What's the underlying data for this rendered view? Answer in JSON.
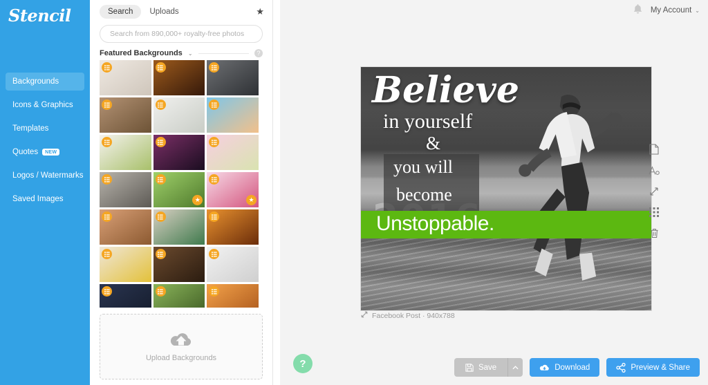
{
  "brand": {
    "name": "Stencil",
    "sidebar_color": "#33a2e5",
    "accent_blue": "#3ea0ee",
    "accent_green": "#5cb811",
    "badge_orange": "#f5a623",
    "help_green": "#84dcab"
  },
  "sidebar": {
    "logo": "Stencil",
    "items": [
      {
        "label": "Backgrounds",
        "active": true,
        "badge": ""
      },
      {
        "label": "Icons & Graphics",
        "active": false,
        "badge": ""
      },
      {
        "label": "Templates",
        "active": false,
        "badge": ""
      },
      {
        "label": "Quotes",
        "active": false,
        "badge": "NEW"
      },
      {
        "label": "Logos / Watermarks",
        "active": false,
        "badge": ""
      },
      {
        "label": "Saved Images",
        "active": false,
        "badge": ""
      }
    ]
  },
  "panel": {
    "tabs": [
      {
        "label": "Search",
        "active": true
      },
      {
        "label": "Uploads",
        "active": false
      }
    ],
    "favorites_icon": "star-icon",
    "search": {
      "value": "",
      "placeholder": "Search from 890,000+ royalty-free photos"
    },
    "section": {
      "title": "Featured Backgrounds",
      "caret": "⌄",
      "help_icon": "question-circle-icon",
      "help_glyph": "?"
    },
    "thumbnails": [
      {
        "alt": "desk-keyboard-notebook-coffee",
        "badge": "list-icon",
        "premium": false,
        "c1": "#efe9e2",
        "c2": "#cfc6bb"
      },
      {
        "alt": "sunset-through-grass",
        "badge": "list-icon",
        "premium": false,
        "c1": "#9c5a1c",
        "c2": "#35190a"
      },
      {
        "alt": "people-meeting-office",
        "badge": "list-icon",
        "premium": false,
        "c1": "#6d6f72",
        "c2": "#2e3135"
      },
      {
        "alt": "blank-picture-frame-wood",
        "badge": "list-icon",
        "premium": false,
        "c1": "#b39274",
        "c2": "#6d5336"
      },
      {
        "alt": "white-desk-plant-laptop",
        "badge": "list-icon",
        "premium": false,
        "c1": "#f0f0ee",
        "c2": "#c9cdc6"
      },
      {
        "alt": "ocean-sunset-horizon",
        "badge": "list-icon",
        "premium": false,
        "c1": "#7ec6e8",
        "c2": "#f2c08a"
      },
      {
        "alt": "pink-rose-leaves",
        "badge": "list-icon",
        "premium": false,
        "c1": "#f5f2ee",
        "c2": "#a8c06a"
      },
      {
        "alt": "purple-dramatic-sky-tree",
        "badge": "list-icon",
        "premium": false,
        "c1": "#7b2f66",
        "c2": "#1a0d20"
      },
      {
        "alt": "pastel-candy-hearts",
        "badge": "list-icon",
        "premium": false,
        "c1": "#f7cfe0",
        "c2": "#d9e3b0"
      },
      {
        "alt": "couple-street-balloons",
        "badge": "list-icon",
        "premium": false,
        "c1": "#b8b4ac",
        "c2": "#5d5a55"
      },
      {
        "alt": "green-field-lone-tree",
        "badge": "list-icon",
        "premium": true,
        "c1": "#9fd06a",
        "c2": "#4f7a2c"
      },
      {
        "alt": "pink-peony-flower-closeup",
        "badge": "list-icon",
        "premium": true,
        "c1": "#f6d9e6",
        "c2": "#d4557e"
      },
      {
        "alt": "coffee-cups-macarons",
        "badge": "list-icon",
        "premium": false,
        "c1": "#d9a077",
        "c2": "#8c5a31"
      },
      {
        "alt": "colorful-tools-flatlay",
        "badge": "list-icon",
        "premium": false,
        "c1": "#d8cfc2",
        "c2": "#3f7a4d"
      },
      {
        "alt": "orange-cathedral-arches",
        "badge": "list-icon",
        "premium": false,
        "c1": "#e8912f",
        "c2": "#6b2d0a"
      },
      {
        "alt": "yellow-lemons-heart-shape",
        "badge": "list-icon",
        "premium": false,
        "c1": "#efe6d8",
        "c2": "#e3c13a"
      },
      {
        "alt": "seedling-sprout-soil",
        "badge": "list-icon",
        "premium": false,
        "c1": "#6b4a2e",
        "c2": "#2b1c10"
      },
      {
        "alt": "colorful-balance-bikes",
        "badge": "list-icon",
        "premium": false,
        "c1": "#f2f2f2",
        "c2": "#cfcfcf"
      },
      {
        "alt": "night-sky-dark-blue",
        "badge": "list-icon",
        "premium": false,
        "c1": "#2a3550",
        "c2": "#141b2b"
      },
      {
        "alt": "green-leaves-blur",
        "badge": "list-icon",
        "premium": false,
        "c1": "#8ab45a",
        "c2": "#3d5a22"
      },
      {
        "alt": "warm-orange-bokeh",
        "badge": "list-icon",
        "premium": false,
        "c1": "#f3a24a",
        "c2": "#a8551a"
      }
    ],
    "upload": {
      "label": "Upload Backgrounds",
      "icon": "cloud-upload-icon"
    }
  },
  "header": {
    "notifications_icon": "bell-icon",
    "account_label": "My Account",
    "account_caret": "⌄"
  },
  "canvas": {
    "caption": "Facebook Post · 940x788",
    "caption_icon": "resize-diagonal-icon",
    "quote": {
      "line1": "Believe",
      "line2": "in yourself",
      "line3": "&",
      "line4": "you will",
      "line5": "become",
      "line6": "Unstoppable.",
      "highlight_color": "#5cb811",
      "box_color": "rgba(60,60,60,.72)"
    },
    "photo": {
      "alt": "grayscale-sprinter-running-on-track",
      "watermark": "2016"
    }
  },
  "tools": [
    {
      "name": "page-icon",
      "label": "Background"
    },
    {
      "name": "text-icon",
      "label": "Text"
    },
    {
      "name": "resize-icon",
      "label": "Resize"
    },
    {
      "name": "grid-icon",
      "label": "Grid"
    },
    {
      "name": "trash-icon",
      "label": "Delete"
    }
  ],
  "help_fab": {
    "glyph": "?",
    "name": "help-button"
  },
  "actions": {
    "save": {
      "label": "Save",
      "icon": "floppy-icon",
      "disabled": true
    },
    "save_caret": "⌃",
    "download": {
      "label": "Download",
      "icon": "cloud-download-icon"
    },
    "preview": {
      "label": "Preview & Share",
      "icon": "share-icon"
    }
  }
}
